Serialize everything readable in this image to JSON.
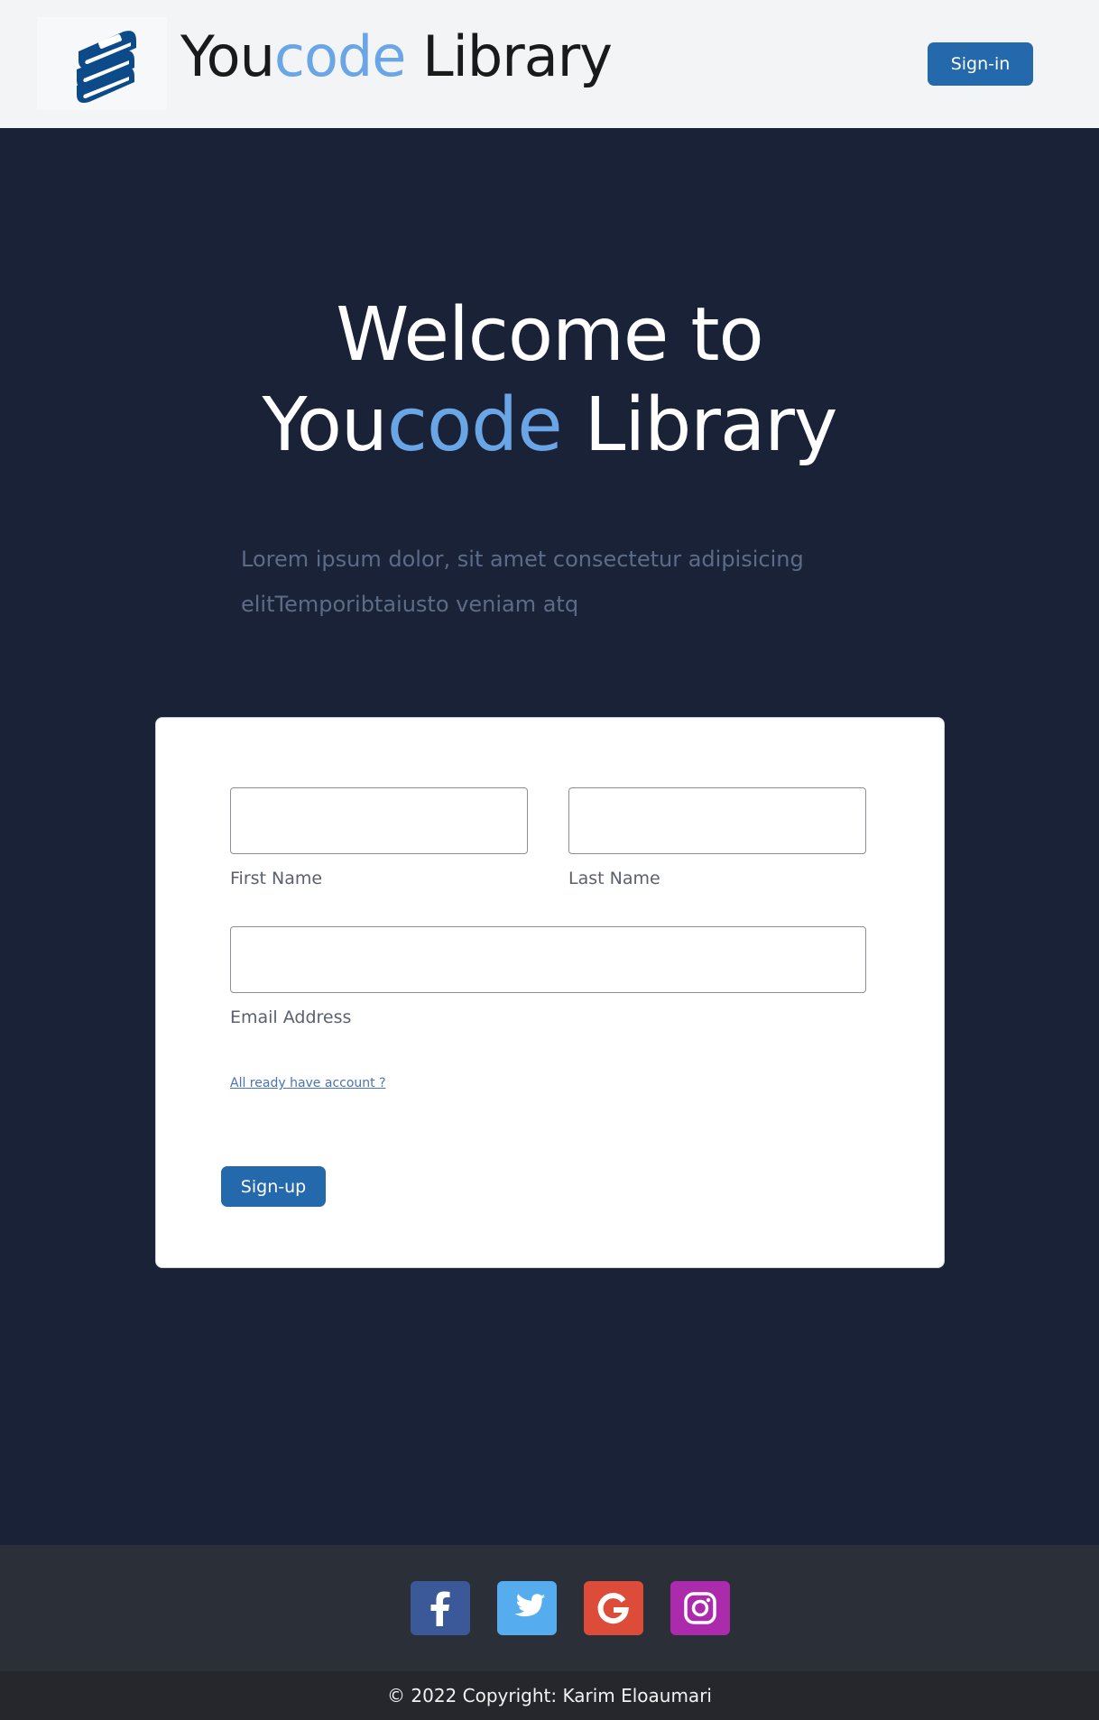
{
  "header": {
    "brand_prefix": "You",
    "brand_accent": "code",
    "brand_suffix": " Library",
    "signin_label": "Sign-in"
  },
  "hero": {
    "title_line1": "Welcome to",
    "title_prefix": "You",
    "title_accent": "code",
    "title_suffix": " Library",
    "description": "Lorem ipsum dolor, sit amet consectetur adipisicing elitTemporibtaiusto veniam atq"
  },
  "form": {
    "first_name_label": "First Name",
    "first_name_value": "",
    "last_name_label": "Last Name",
    "last_name_value": "",
    "email_label": "Email Address",
    "email_value": "",
    "account_link": "All ready have account ?",
    "signup_label": "Sign-up"
  },
  "footer": {
    "social": [
      "facebook-icon",
      "twitter-icon",
      "google-icon",
      "instagram-icon"
    ],
    "copyright": "© 2022 Copyright: Karim Eloaumari"
  },
  "colors": {
    "accent": "#6aa6e6",
    "primary_button": "#2569ad",
    "page_bg": "#1a2238",
    "facebook": "#3b5998",
    "twitter": "#55acee",
    "google": "#dd4b39",
    "instagram": "#ac2bac"
  }
}
